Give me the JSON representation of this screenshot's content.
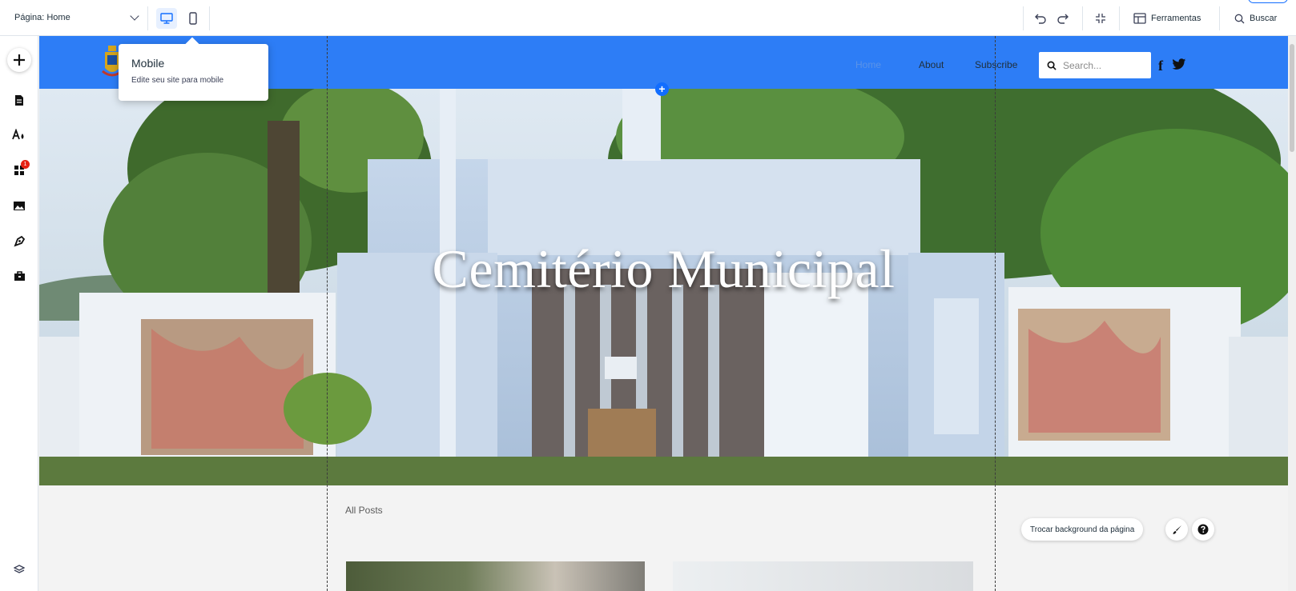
{
  "toolbar": {
    "page_selector": "Página: Home",
    "tools_label": "Ferramentas",
    "search_label": "Buscar"
  },
  "tooltip": {
    "title": "Mobile",
    "subtitle": "Edite seu site para mobile"
  },
  "left_panel": {
    "items": [
      "add-elements",
      "pages",
      "design",
      "apps",
      "media",
      "blog",
      "business"
    ],
    "apps_badge": "1"
  },
  "site": {
    "nav": [
      "Home",
      "About",
      "Subscribe"
    ],
    "search_placeholder": "Search...",
    "social": [
      "f",
      "🐦"
    ],
    "hero_title": "Cemitério Municipal",
    "all_posts_label": "All Posts"
  },
  "page_actions": {
    "change_background": "Trocar background da página"
  },
  "colors": {
    "header_bg": "#2d7df6",
    "accent": "#116dff",
    "badge": "#e62214"
  }
}
